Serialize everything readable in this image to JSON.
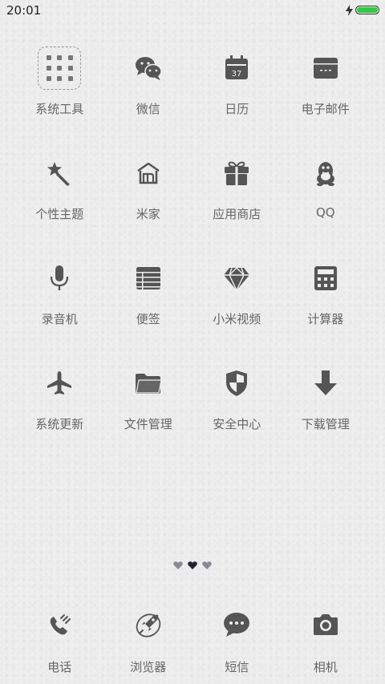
{
  "status_bar": {
    "time": "20:01",
    "battery_color": "#2ecc40"
  },
  "apps": [
    {
      "label": "系统工具",
      "icon": "folder-icon"
    },
    {
      "label": "微信",
      "icon": "wechat-icon"
    },
    {
      "label": "日历",
      "icon": "calendar-icon",
      "icon_text": "37"
    },
    {
      "label": "电子邮件",
      "icon": "mail-icon"
    },
    {
      "label": "个性主题",
      "icon": "magic-wand-icon"
    },
    {
      "label": "米家",
      "icon": "mi-home-icon"
    },
    {
      "label": "应用商店",
      "icon": "gift-icon"
    },
    {
      "label": "QQ",
      "icon": "qq-penguin-icon"
    },
    {
      "label": "录音机",
      "icon": "microphone-icon"
    },
    {
      "label": "便签",
      "icon": "notes-icon"
    },
    {
      "label": "小米视频",
      "icon": "diamond-icon"
    },
    {
      "label": "计算器",
      "icon": "calculator-icon"
    },
    {
      "label": "系统更新",
      "icon": "airplane-icon"
    },
    {
      "label": "文件管理",
      "icon": "folder-open-icon"
    },
    {
      "label": "安全中心",
      "icon": "shield-icon"
    },
    {
      "label": "下载管理",
      "icon": "download-arrow-icon"
    }
  ],
  "page_indicator": {
    "count": 3,
    "active": 1
  },
  "dock": [
    {
      "label": "电话",
      "icon": "phone-icon"
    },
    {
      "label": "浏览器",
      "icon": "rocket-browser-icon"
    },
    {
      "label": "短信",
      "icon": "message-bubble-icon"
    },
    {
      "label": "相机",
      "icon": "camera-icon"
    }
  ]
}
